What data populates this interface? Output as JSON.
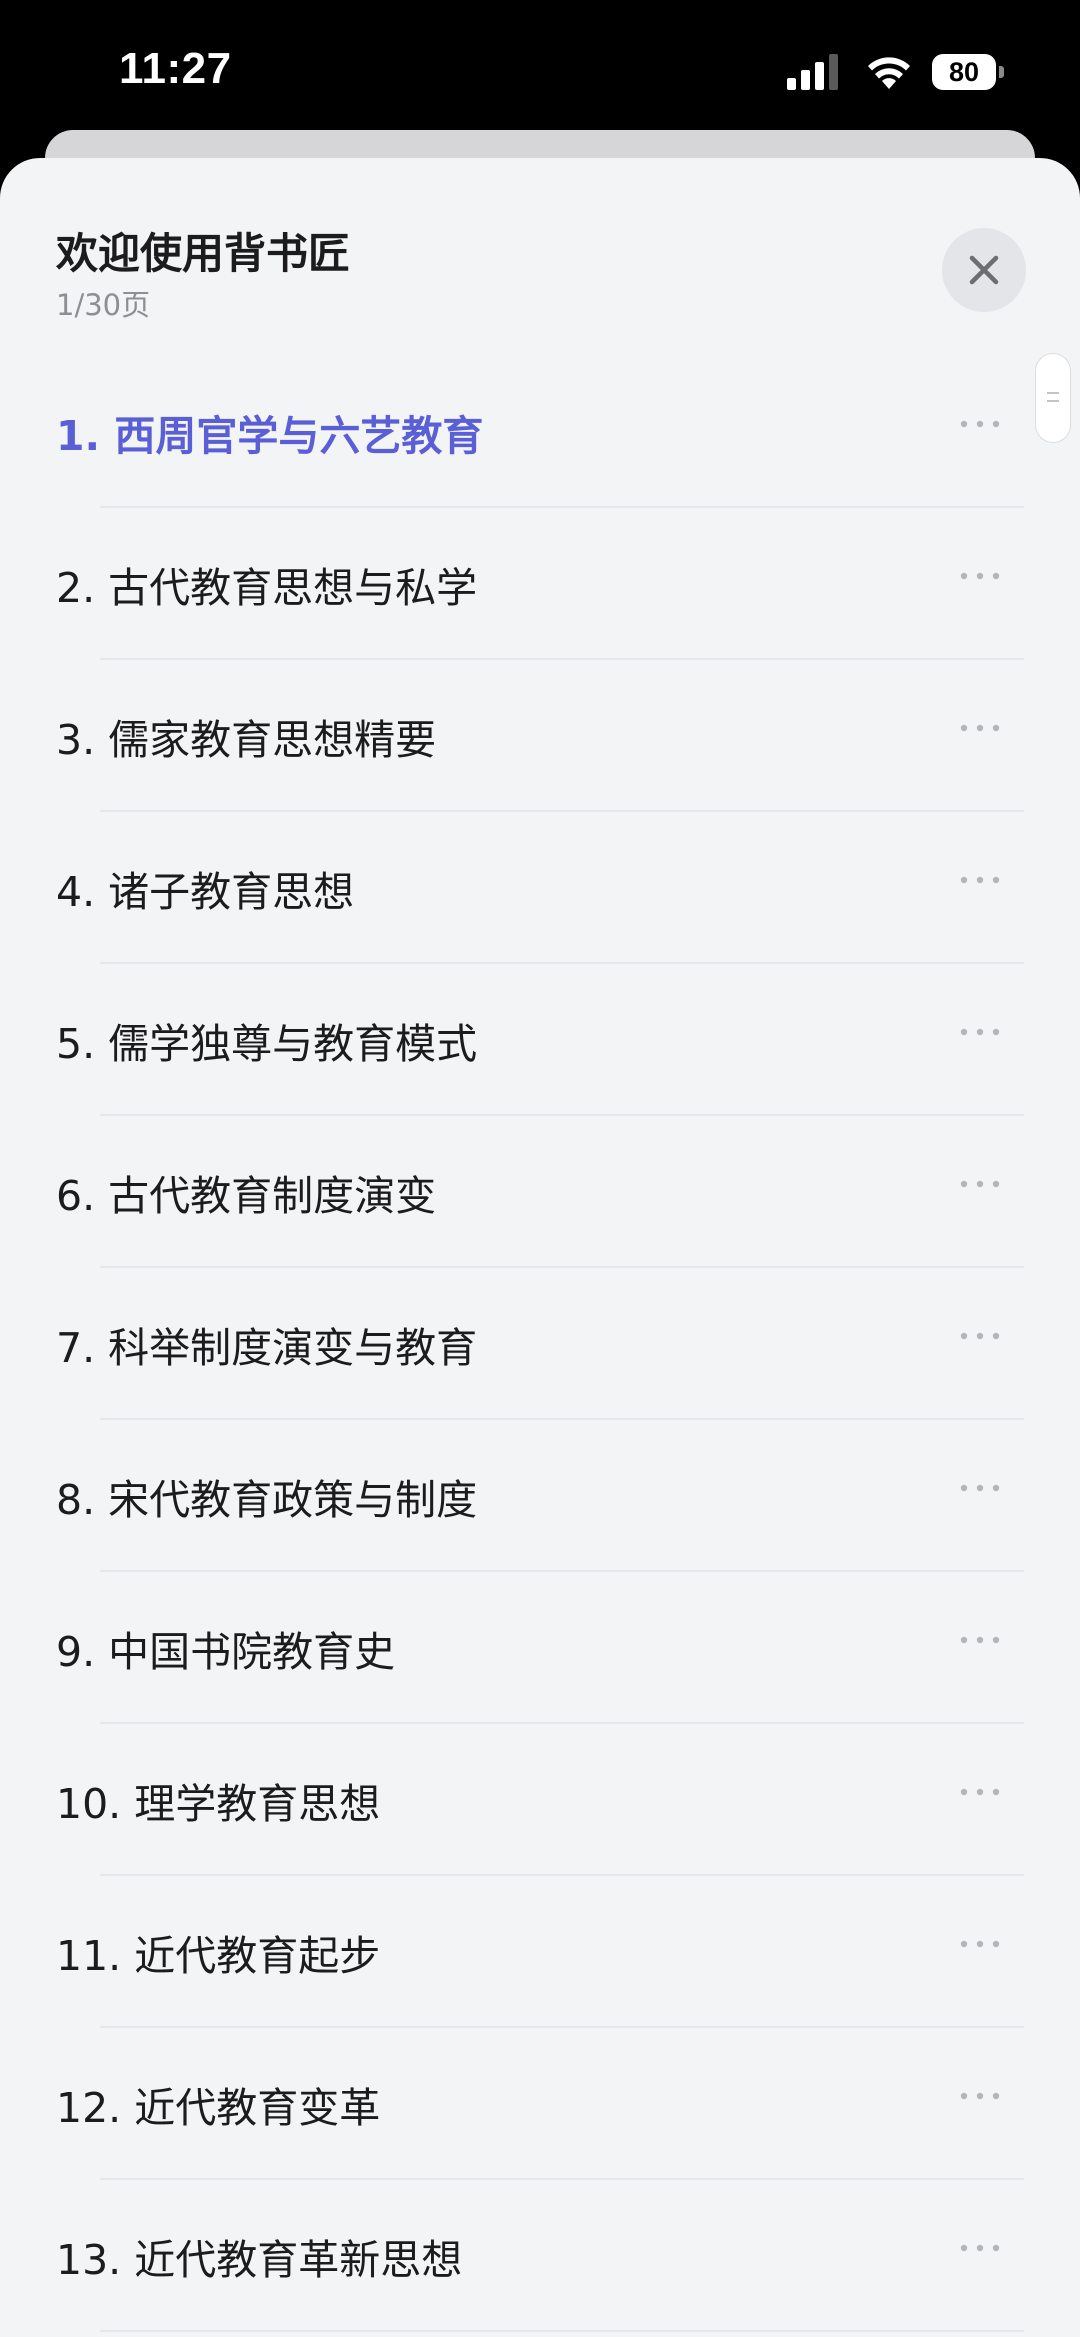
{
  "status_bar": {
    "time": "11:27",
    "battery": "80",
    "signal_icon": "cellular-signal-icon",
    "wifi_icon": "wifi-icon",
    "battery_icon": "battery-icon"
  },
  "sheet": {
    "title": "欢迎使用背书匠",
    "subtitle": "1/30页",
    "close_icon": "close-icon",
    "accent_color": "#5b5fd6"
  },
  "chapters": [
    {
      "label": "1. 西周官学与六艺教育",
      "active": true
    },
    {
      "label": "2. 古代教育思想与私学",
      "active": false
    },
    {
      "label": "3. 儒家教育思想精要",
      "active": false
    },
    {
      "label": "4. 诸子教育思想",
      "active": false
    },
    {
      "label": "5. 儒学独尊与教育模式",
      "active": false
    },
    {
      "label": "6. 古代教育制度演变",
      "active": false
    },
    {
      "label": "7. 科举制度演变与教育",
      "active": false
    },
    {
      "label": "8. 宋代教育政策与制度",
      "active": false
    },
    {
      "label": "9. 中国书院教育史",
      "active": false
    },
    {
      "label": "10. 理学教育思想",
      "active": false
    },
    {
      "label": "11. 近代教育起步",
      "active": false
    },
    {
      "label": "12. 近代教育变革",
      "active": false
    },
    {
      "label": "13. 近代教育革新思想",
      "active": false
    }
  ]
}
